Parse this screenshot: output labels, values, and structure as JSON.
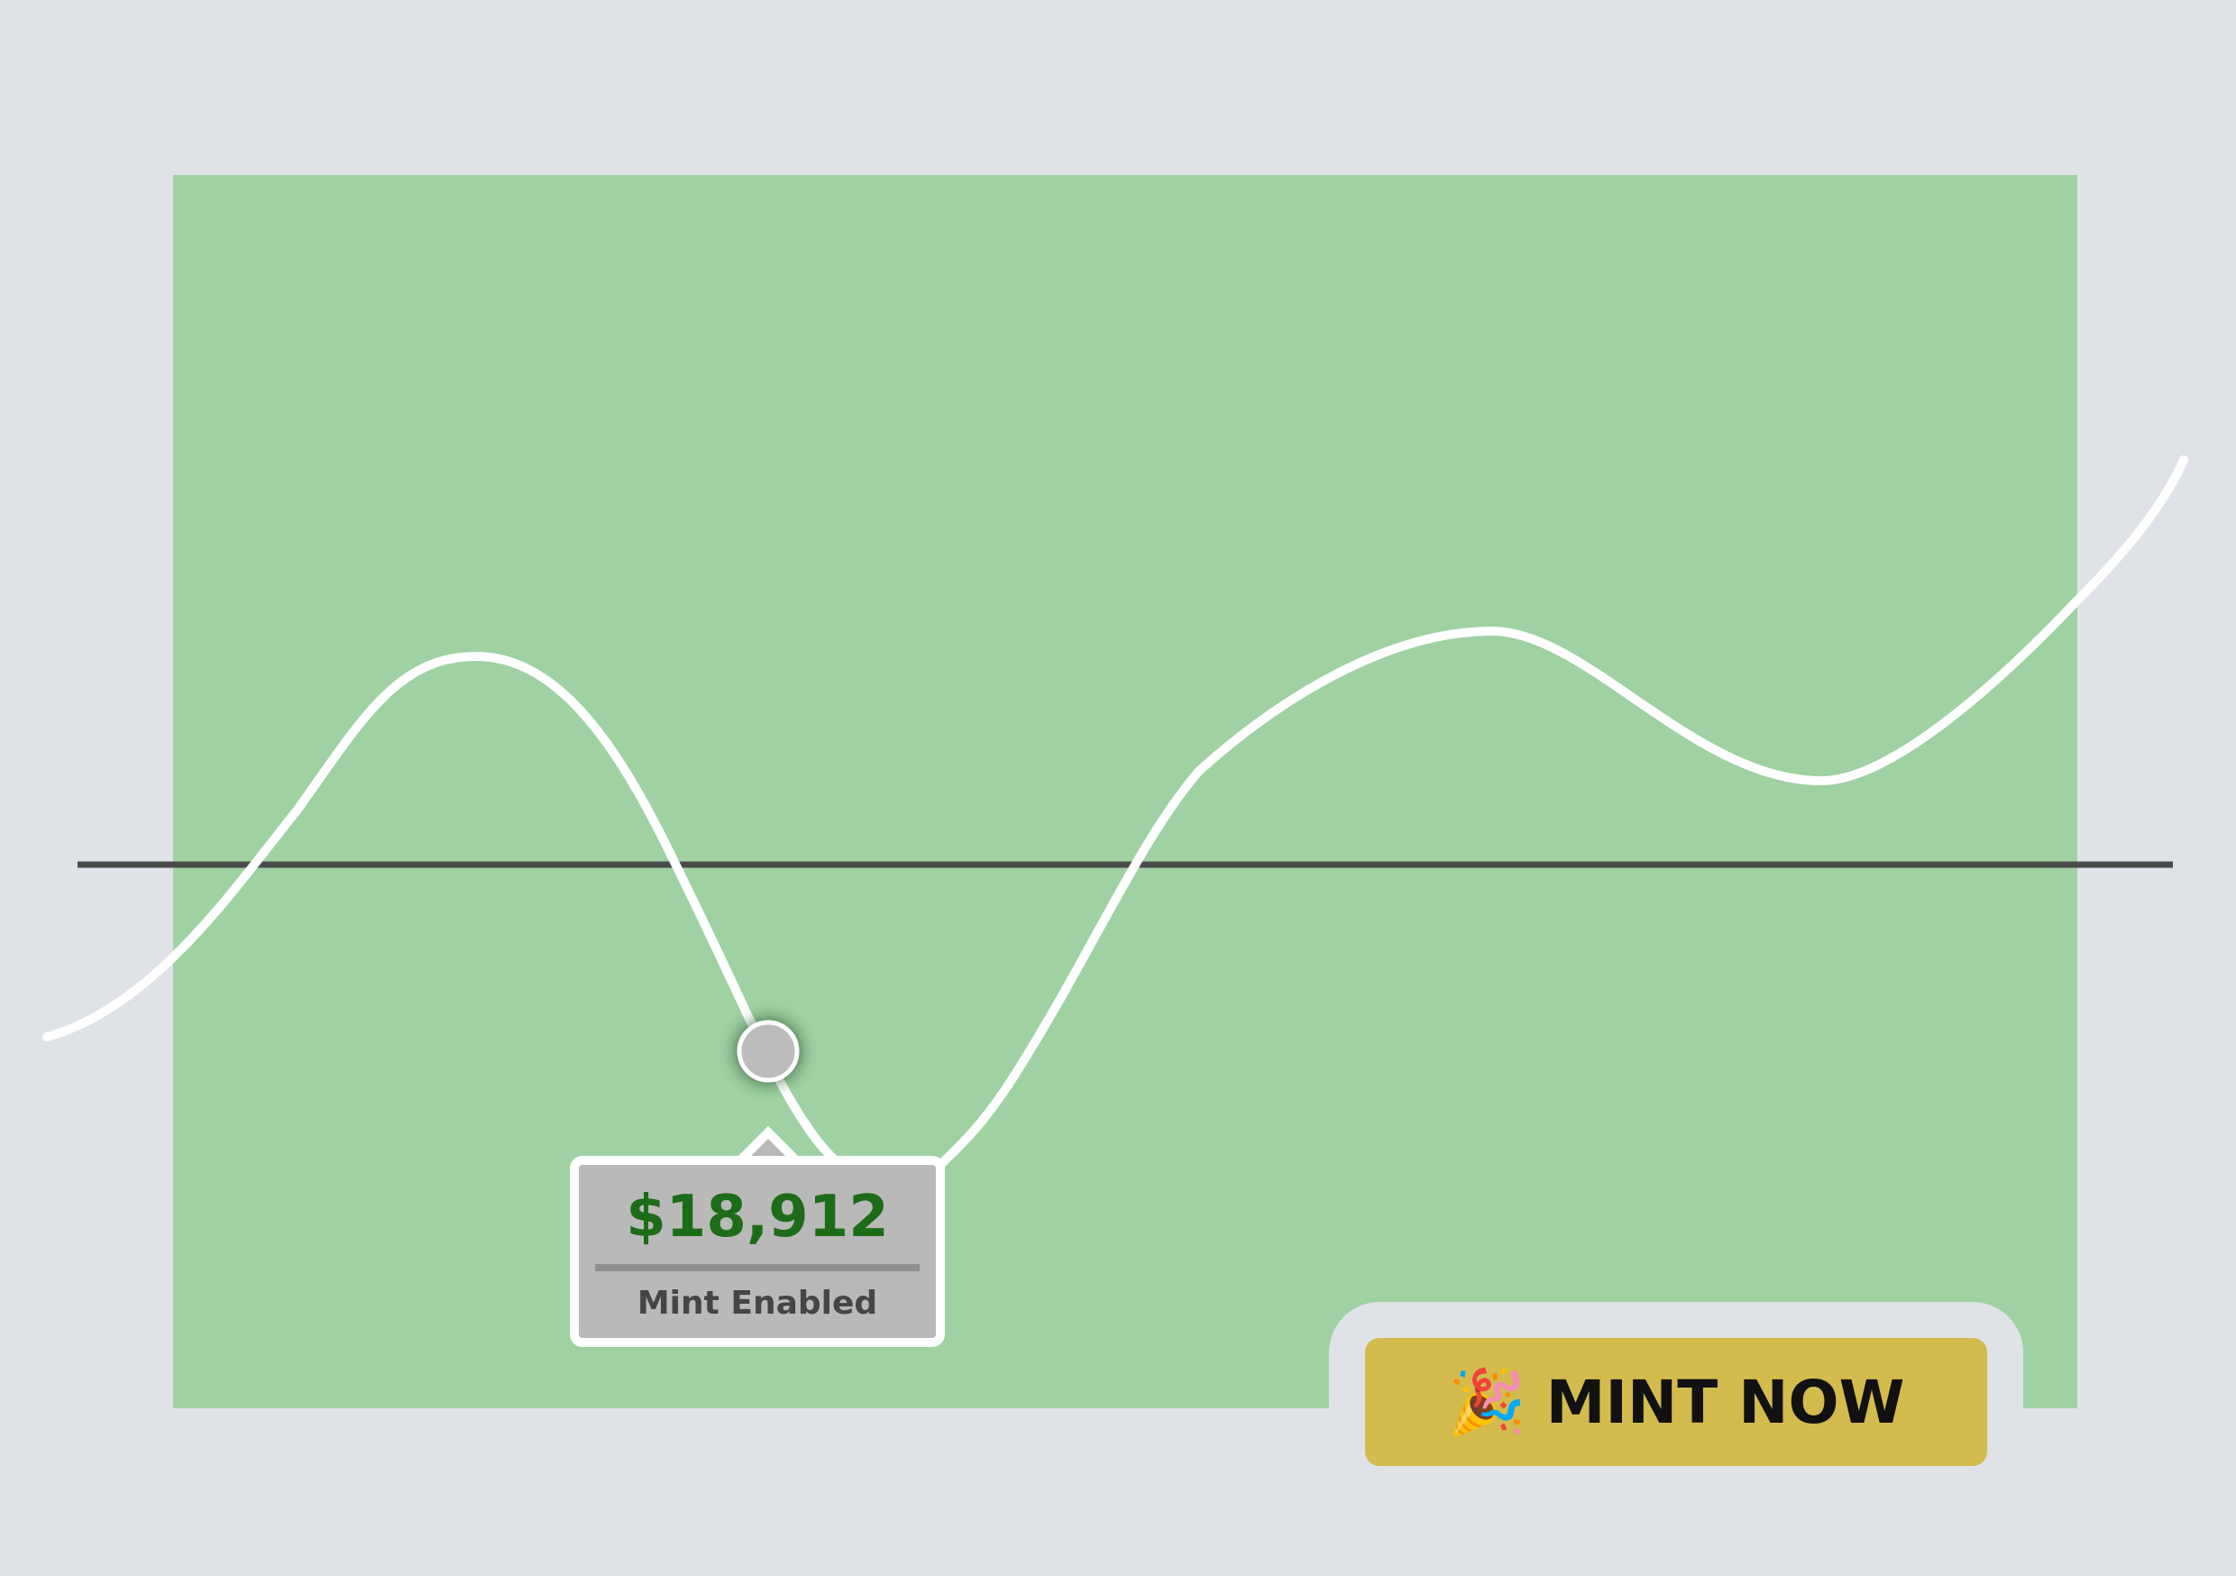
{
  "tooltip": {
    "value": "$18,912",
    "label": "Mint Enabled"
  },
  "mint_button": {
    "emoji": "🎉",
    "label": "MINT NOW"
  },
  "icons": {
    "hover_point": "data-point-marker-icon",
    "party": "party-popper-icon"
  },
  "colors": {
    "background": "#dfe2e6",
    "chart_panel": "#9fd1a3",
    "line": "#ffffff",
    "baseline": "#4a4a4a",
    "tooltip_bg": "#b9b9b9",
    "tooltip_value": "#1d6c18",
    "tooltip_label": "#454545",
    "button_bg": "#d3bb4d"
  }
}
